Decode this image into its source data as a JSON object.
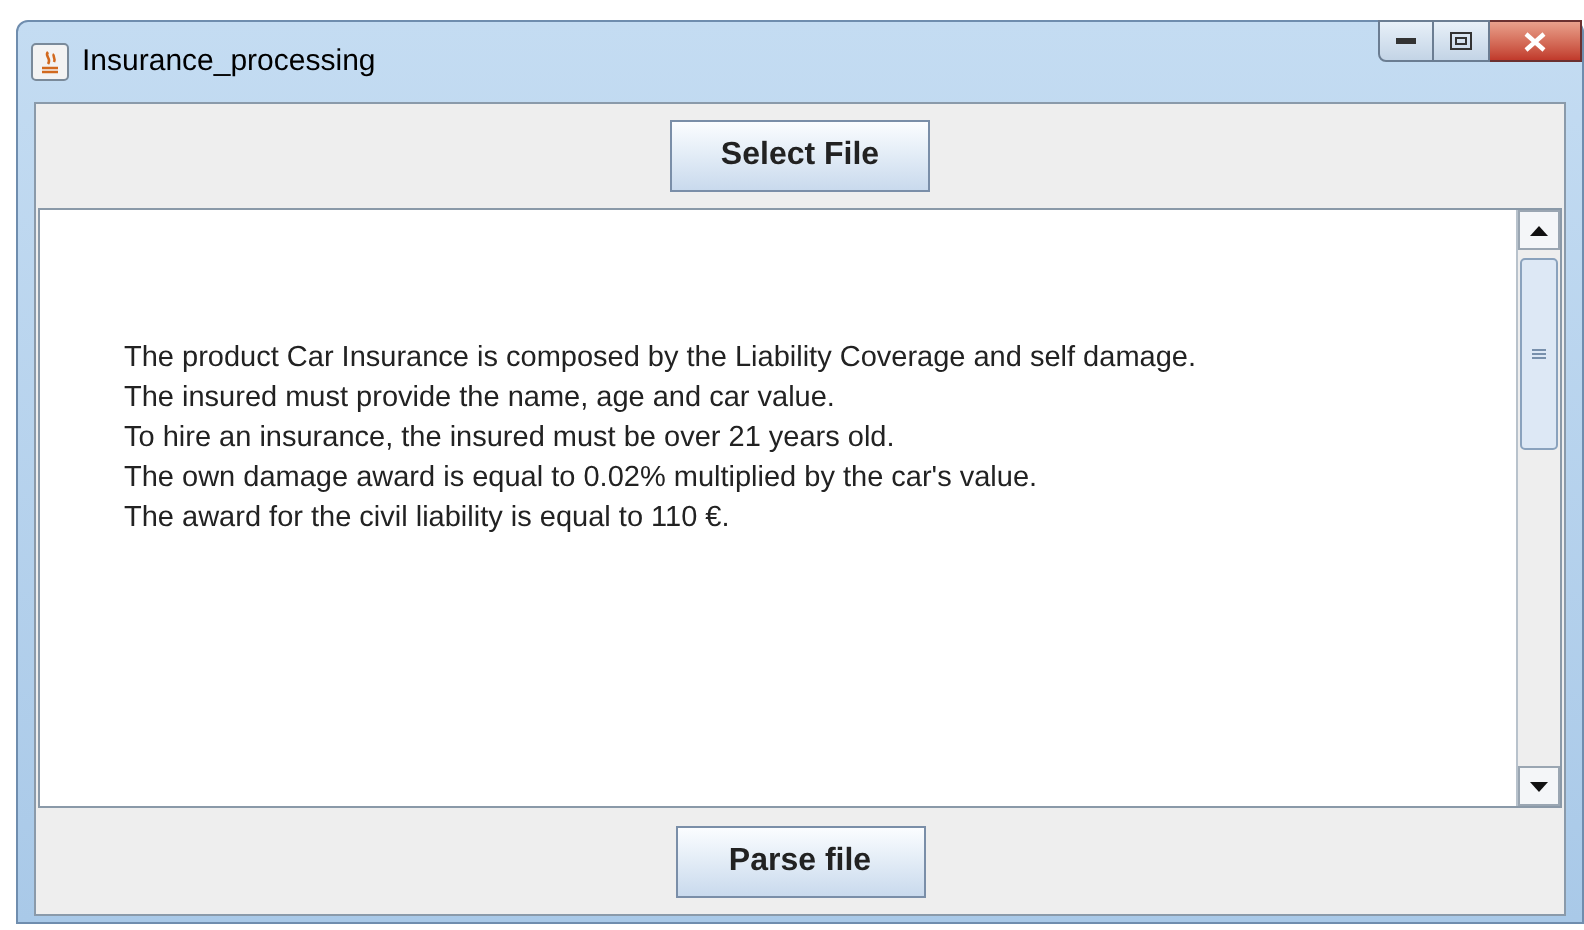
{
  "window": {
    "title": "Insurance_processing"
  },
  "top_button": {
    "label": "Select File"
  },
  "text_area": {
    "lines": [
      "The product Car Insurance is composed by the Liability Coverage and self damage.",
      "The insured must provide the name, age and car value.",
      "To hire an insurance, the insured must be over 21 years old.",
      "The own damage award is equal to 0.02% multiplied by the car's value.",
      "The award for the civil liability is equal to 110 €."
    ]
  },
  "bottom_button": {
    "label": "Parse file"
  }
}
